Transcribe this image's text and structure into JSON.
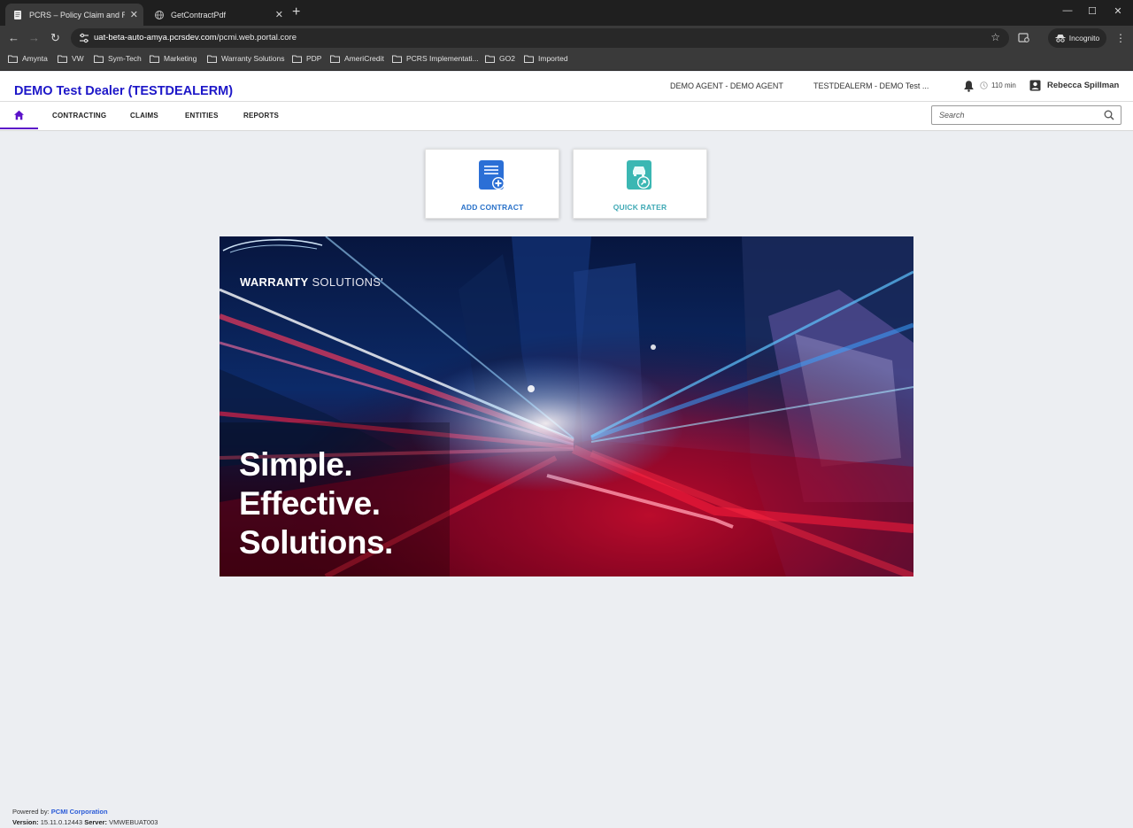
{
  "browser": {
    "tabs": [
      {
        "title": "PCRS – Policy Claim and Reporti",
        "active": true
      },
      {
        "title": "GetContractPdf",
        "active": false
      }
    ],
    "url_domain": "uat-beta-auto-amya.pcrsdev.com",
    "url_path": "/pcmi.web.portal.core",
    "profile_label": "Incognito",
    "bookmarks": [
      "Amynta",
      "VW",
      "Sym-Tech",
      "Marketing",
      "Warranty Solutions",
      "PDP",
      "AmeriCredit",
      "PCRS Implementati...",
      "GO2",
      "Imported"
    ]
  },
  "header": {
    "dealer_title": "DEMO Test Dealer (TESTDEALERM)",
    "agent_context": "DEMO AGENT - DEMO AGENT",
    "dealer_context": "TESTDEALERM - DEMO Test ...",
    "session_timer": "110 min",
    "user_name": "Rebecca Spillman"
  },
  "nav": {
    "items": [
      "CONTRACTING",
      "CLAIMS",
      "ENTITIES",
      "REPORTS"
    ],
    "search_placeholder": "Search",
    "accent_color": "#5b12c9"
  },
  "actions": {
    "add_contract": "ADD CONTRACT",
    "quick_rater": "QUICK RATER"
  },
  "hero": {
    "brand_bold": "WARRANTY",
    "brand_light": "SOLUTIONS",
    "brand_mark": "'",
    "tagline": [
      "Simple.",
      "Effective.",
      "Solutions."
    ]
  },
  "footer": {
    "powered_by_label": "Powered by:",
    "company": "PCMI Corporation",
    "version_label": "Version:",
    "version": "15.11.0.12443",
    "server_label": "Server:",
    "server": "VMWEBUAT003"
  }
}
